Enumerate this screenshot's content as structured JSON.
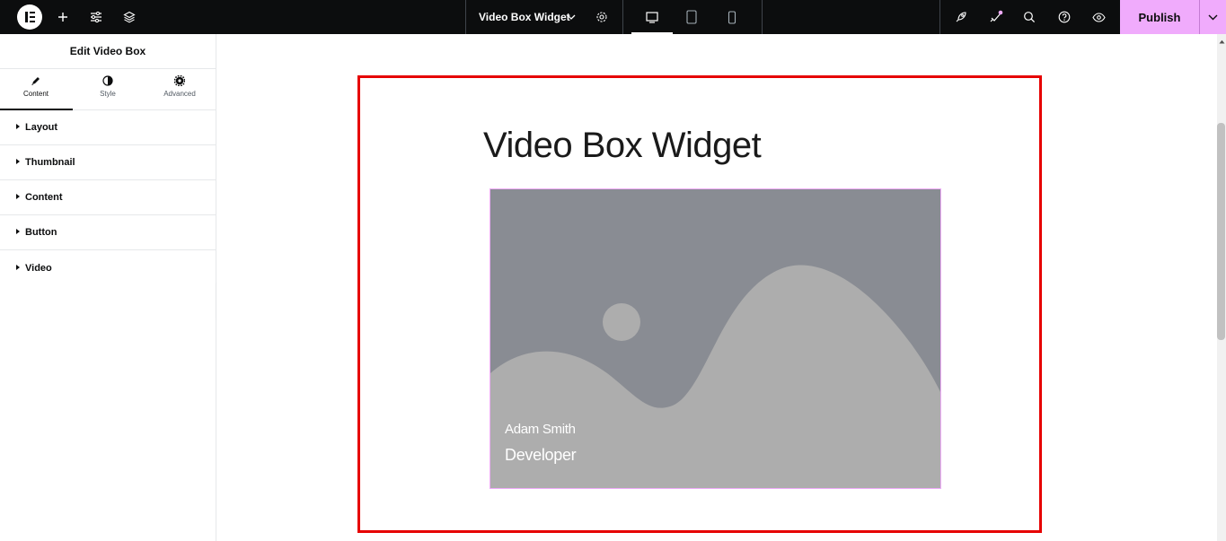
{
  "topbar": {
    "logo": "elementor-logo-icon",
    "add_icon": "plus-icon",
    "settings_icon": "sliders-icon",
    "structure_icon": "layers-icon",
    "document_title": "Video Box Widget",
    "document_menu_icon": "chevron-down-icon",
    "page_settings_icon": "gear-icon",
    "devices": [
      "desktop-icon",
      "tablet-icon",
      "mobile-icon"
    ],
    "active_device": "desktop",
    "right_icons": [
      "rocket-icon",
      "whats-new-icon",
      "search-icon",
      "help-icon",
      "preview-eye-icon"
    ],
    "publish_label": "Publish",
    "publish_menu_icon": "chevron-down-icon",
    "publish_color": "#f0abfc"
  },
  "panel": {
    "title": "Edit Video Box",
    "tabs": [
      {
        "label": "Content",
        "icon": "pencil-icon",
        "active": true
      },
      {
        "label": "Style",
        "icon": "contrast-icon",
        "active": false
      },
      {
        "label": "Advanced",
        "icon": "gear-icon",
        "active": false
      }
    ],
    "sections": [
      "Layout",
      "Thumbnail",
      "Content",
      "Button",
      "Video"
    ],
    "collapse_icon": "chevron-left-icon"
  },
  "canvas": {
    "heading": "Video Box Widget",
    "thumbnail": "image-placeholder",
    "name": "Adam Smith",
    "role": "Developer",
    "frame_color": "#e60000"
  }
}
